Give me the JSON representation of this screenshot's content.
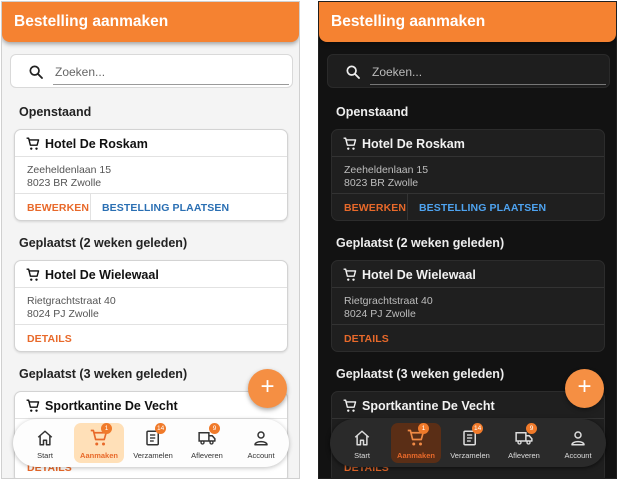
{
  "screens": [
    {
      "theme": "light",
      "title": "Bestelling aanmaken",
      "search": {
        "placeholder": "Zoeken...",
        "value": ""
      },
      "sections": [
        {
          "heading": "Openstaand"
        },
        {
          "heading": "Geplaatst (2 weken geleden)"
        },
        {
          "heading": "Geplaatst (3 weken geleden)"
        }
      ],
      "cards": [
        {
          "name": "Hotel De Roskam",
          "address_line1": "Zeeheldenlaan 15",
          "address_line2": "8023 BR Zwolle",
          "action1": "BEWERKEN",
          "action2": "BESTELLING PLAATSEN"
        },
        {
          "name": "Hotel De Wielewaal",
          "address_line1": "Rietgrachtstraat 40",
          "address_line2": "8024 PJ Zwolle",
          "action1": "DETAILS"
        },
        {
          "name": "Sportkantine De Vecht",
          "action1": "DETAILS"
        }
      ],
      "fab_label": "+",
      "nav": [
        {
          "label": "Start",
          "icon": "home-icon",
          "badge": ""
        },
        {
          "label": "Aanmaken",
          "icon": "cart-icon",
          "badge": "1",
          "active": true
        },
        {
          "label": "Verzamelen",
          "icon": "clipboard-list-icon",
          "badge": "14"
        },
        {
          "label": "Afleveren",
          "icon": "truck-icon",
          "badge": "9"
        },
        {
          "label": "Account",
          "icon": "person-icon",
          "badge": ""
        }
      ]
    },
    {
      "theme": "dark",
      "title": "Bestelling aanmaken",
      "search": {
        "placeholder": "Zoeken...",
        "value": ""
      },
      "sections": [
        {
          "heading": "Openstaand"
        },
        {
          "heading": "Geplaatst (2 weken geleden)"
        },
        {
          "heading": "Geplaatst (3 weken geleden)"
        }
      ],
      "cards": [
        {
          "name": "Hotel De Roskam",
          "address_line1": "Zeeheldenlaan 15",
          "address_line2": "8023 BR Zwolle",
          "action1": "BEWERKEN",
          "action2": "BESTELLING PLAATSEN"
        },
        {
          "name": "Hotel De Wielewaal",
          "address_line1": "Rietgrachtstraat 40",
          "address_line2": "8024 PJ Zwolle",
          "action1": "DETAILS"
        },
        {
          "name": "Sportkantine De Vecht",
          "action1": "DETAILS"
        }
      ],
      "fab_label": "+",
      "nav": [
        {
          "label": "Start",
          "icon": "home-icon",
          "badge": ""
        },
        {
          "label": "Aanmaken",
          "icon": "cart-icon",
          "badge": "1",
          "active": true
        },
        {
          "label": "Verzamelen",
          "icon": "clipboard-list-icon",
          "badge": "14"
        },
        {
          "label": "Afleveren",
          "icon": "truck-icon",
          "badge": "9"
        },
        {
          "label": "Account",
          "icon": "person-icon",
          "badge": ""
        }
      ]
    }
  ],
  "colors": {
    "primary": "#f58231",
    "accent_orange": "#e8692a",
    "link_blue_light": "#2a6fb3",
    "link_blue_dark": "#4ea3f0",
    "bg_light": "#f4f4f4",
    "bg_dark": "#121212"
  }
}
